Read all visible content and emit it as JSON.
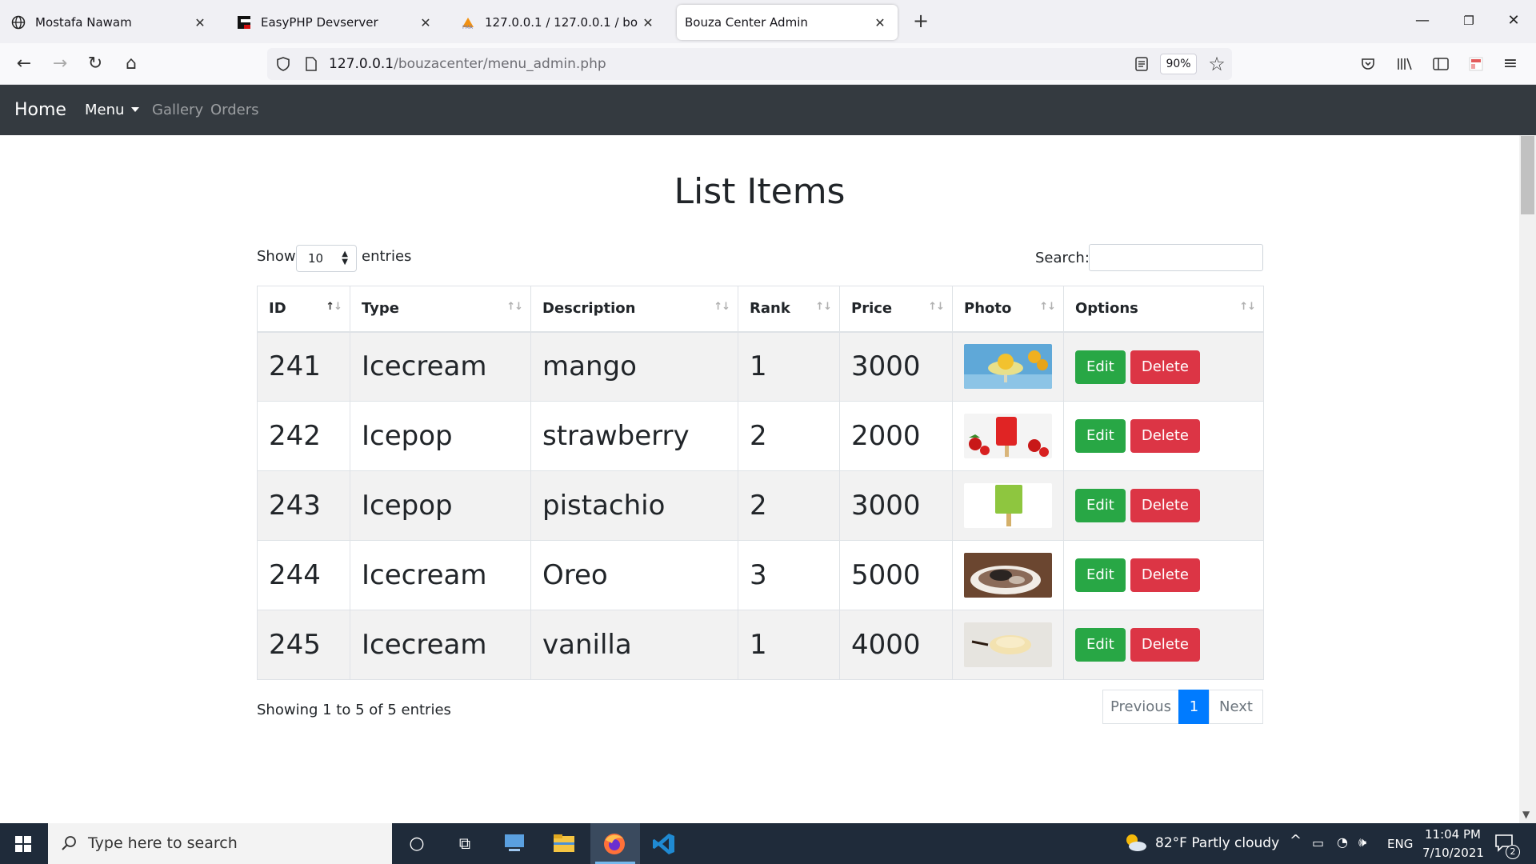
{
  "browser": {
    "tabs": [
      {
        "title": "Mostafa Nawam",
        "icon": "globe-icon"
      },
      {
        "title": "EasyPHP Devserver",
        "icon": "easyphp-icon"
      },
      {
        "title": "127.0.0.1 / 127.0.0.1 / bouzacenter",
        "icon": "phpmyadmin-icon"
      },
      {
        "title": "Bouza Center Admin",
        "icon": ""
      }
    ],
    "url_host": "127.0.0.1",
    "url_path": "/bouzacenter/menu_admin.php",
    "zoom": "90%"
  },
  "site_nav": {
    "brand": "Home",
    "menu": "Menu",
    "gallery": "Gallery",
    "orders": "Orders"
  },
  "page": {
    "title": "List Items",
    "show_label": "Show",
    "entries_value": "10",
    "entries_label": "entries",
    "search_label": "Search:",
    "search_value": ""
  },
  "table": {
    "columns": [
      "ID",
      "Type",
      "Description",
      "Rank",
      "Price",
      "Photo",
      "Options"
    ],
    "rows": [
      {
        "id": "241",
        "type": "Icecream",
        "description": "mango",
        "rank": "1",
        "price": "3000",
        "photo": "mango-icecream-photo"
      },
      {
        "id": "242",
        "type": "Icepop",
        "description": "strawberry",
        "rank": "2",
        "price": "2000",
        "photo": "strawberry-icepop-photo"
      },
      {
        "id": "243",
        "type": "Icepop",
        "description": "pistachio",
        "rank": "2",
        "price": "3000",
        "photo": "pistachio-icepop-photo"
      },
      {
        "id": "244",
        "type": "Icecream",
        "description": "Oreo",
        "rank": "3",
        "price": "5000",
        "photo": "oreo-icecream-photo"
      },
      {
        "id": "245",
        "type": "Icecream",
        "description": "vanilla",
        "rank": "1",
        "price": "4000",
        "photo": "vanilla-icecream-photo"
      }
    ],
    "edit_label": "Edit",
    "delete_label": "Delete",
    "info": "Showing 1 to 5 of 5 entries",
    "previous": "Previous",
    "page": "1",
    "next": "Next"
  },
  "taskbar": {
    "search_placeholder": "Type here to search",
    "weather": "82°F  Partly cloudy",
    "language": "ENG",
    "time": "11:04 PM",
    "date": "7/10/2021",
    "notifications": "2"
  },
  "colors": {
    "navbar": "#343a40",
    "edit": "#28a745",
    "delete": "#dc3545",
    "page_active": "#007bff"
  }
}
